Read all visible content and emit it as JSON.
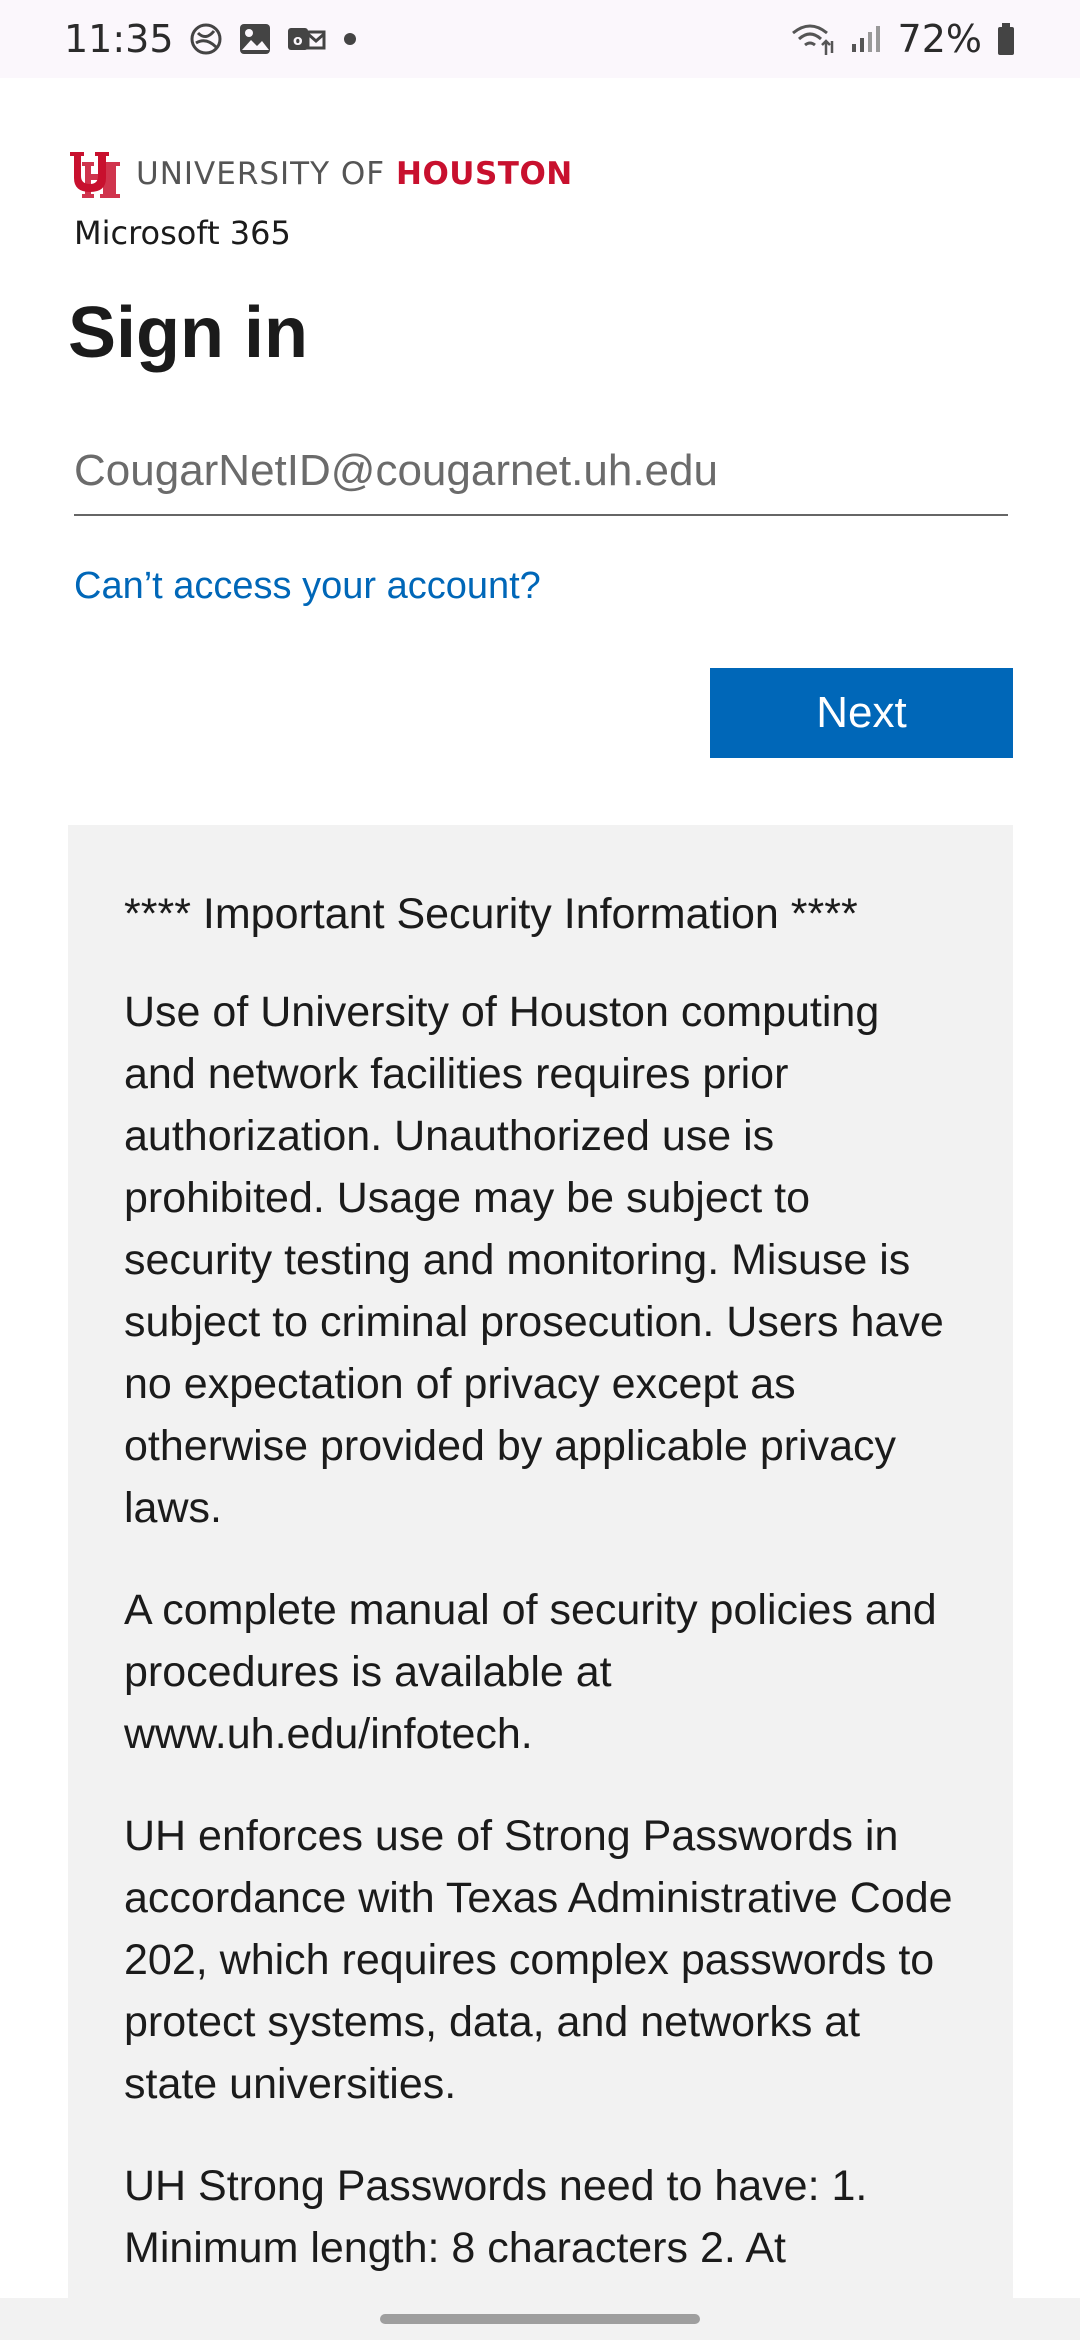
{
  "status_bar": {
    "time": "11:35",
    "battery": "72%",
    "icons": [
      "sync-icon",
      "gallery-icon",
      "outlook-icon",
      "notification-dot-icon",
      "wifi-icon",
      "signal-icon",
      "battery-icon"
    ]
  },
  "brand": {
    "university_prefix": "UNIVERSITY OF ",
    "university_name": "HOUSTON",
    "product": "Microsoft 365",
    "accent_color": "#c8102e"
  },
  "signin": {
    "title": "Sign in",
    "email_placeholder": "CougarNetID@cougarnet.uh.edu",
    "email_value": "",
    "cant_access_label": "Can’t access your account?",
    "next_label": "Next",
    "primary_color": "#0067b8"
  },
  "notice": {
    "heading": "**** Important Security Information ****",
    "paragraphs": [
      "Use of University of Houston computing and network facilities requires prior authorization. Unauthorized use is prohibited. Usage may be subject to security testing and monitoring. Misuse is subject to criminal prosecution. Users have no expectation of privacy except as otherwise provided by applicable privacy laws.",
      "A complete manual of security policies and procedures is available at www.uh.edu/infotech.",
      "UH enforces use of Strong Passwords in accordance with Texas Administrative Code 202, which requires complex passwords to protect systems, data, and networks at state universities.",
      "UH Strong Passwords need to have: 1. Minimum length: 8 characters 2. At"
    ]
  }
}
